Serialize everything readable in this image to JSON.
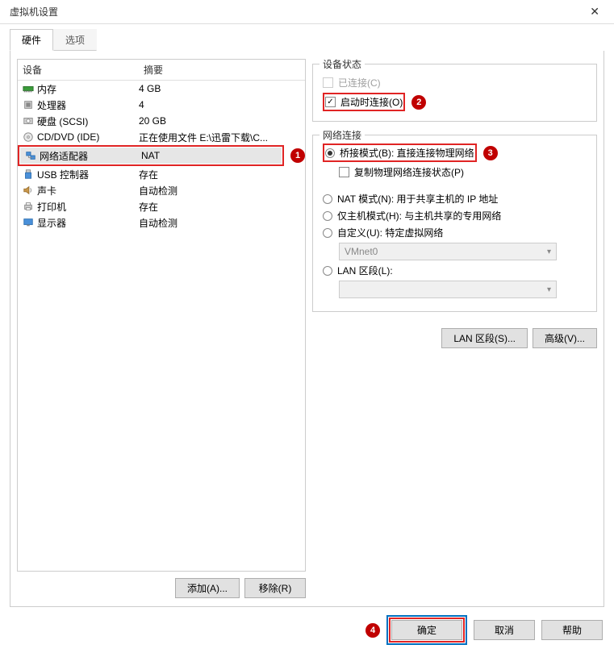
{
  "window": {
    "title": "虚拟机设置"
  },
  "tabs": {
    "hardware": "硬件",
    "options": "选项"
  },
  "device_header": {
    "device": "设备",
    "summary": "摘要"
  },
  "devices": [
    {
      "name": "内存",
      "summary": "4 GB"
    },
    {
      "name": "处理器",
      "summary": "4"
    },
    {
      "name": "硬盘 (SCSI)",
      "summary": "20 GB"
    },
    {
      "name": "CD/DVD (IDE)",
      "summary": "正在使用文件 E:\\迅雷下载\\C..."
    },
    {
      "name": "网络适配器",
      "summary": "NAT"
    },
    {
      "name": "USB 控制器",
      "summary": "存在"
    },
    {
      "name": "声卡",
      "summary": "自动检测"
    },
    {
      "name": "打印机",
      "summary": "存在"
    },
    {
      "name": "显示器",
      "summary": "自动检测"
    }
  ],
  "left_buttons": {
    "add": "添加(A)...",
    "remove": "移除(R)"
  },
  "device_status": {
    "title": "设备状态",
    "connected": "已连接(C)",
    "connect_at_poweron": "启动时连接(O)"
  },
  "network": {
    "title": "网络连接",
    "bridged": "桥接模式(B): 直接连接物理网络",
    "replicate": "复制物理网络连接状态(P)",
    "nat": "NAT 模式(N): 用于共享主机的 IP 地址",
    "hostonly": "仅主机模式(H): 与主机共享的专用网络",
    "custom": "自定义(U): 特定虚拟网络",
    "custom_value": "VMnet0",
    "lan": "LAN 区段(L):",
    "lan_value": "",
    "btn_lan": "LAN 区段(S)...",
    "btn_adv": "高级(V)..."
  },
  "bottom": {
    "ok": "确定",
    "cancel": "取消",
    "help": "帮助"
  },
  "annotations": {
    "a1": "1",
    "a2": "2",
    "a3": "3",
    "a4": "4"
  }
}
